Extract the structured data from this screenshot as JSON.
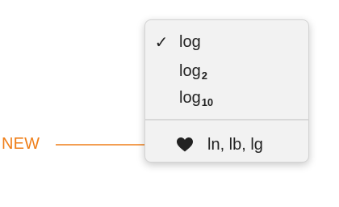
{
  "callout": {
    "label": "NEW",
    "color": "#ef7f1a",
    "icon": "arrow-right-icon"
  },
  "menu": {
    "items": [
      {
        "base": "log",
        "subscript": "",
        "checked": true,
        "icon": "checkmark-icon",
        "check_glyph": "✓"
      },
      {
        "base": "log",
        "subscript": "2",
        "checked": false
      },
      {
        "base": "log",
        "subscript": "10",
        "checked": false
      }
    ],
    "new_item": {
      "label": "ln, lb, lg",
      "icon": "heart-icon"
    }
  }
}
